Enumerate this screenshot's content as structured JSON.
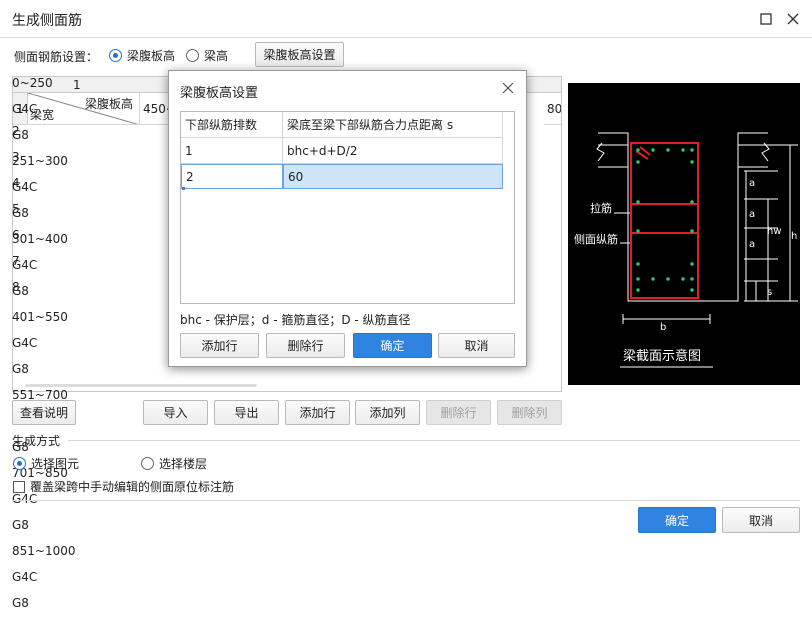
{
  "window": {
    "title": "生成侧面筋"
  },
  "side_bar_setting": {
    "label": "侧面钢筋设置：",
    "option_web_height": "梁腹板高",
    "option_beam_height": "梁高",
    "button": "梁腹板高设置"
  },
  "grid": {
    "col_header_1": "1",
    "corner_top": "梁腹板高",
    "corner_bottom": "梁宽",
    "col1_header_partial": "450<",
    "col_last_header_partial": "80",
    "rows": [
      {
        "num": "2",
        "width": "0~250",
        "val": "G4C",
        "last": "G8"
      },
      {
        "num": "3",
        "width": "251~300",
        "val": "G4C",
        "last": "G8"
      },
      {
        "num": "4",
        "width": "301~400",
        "val": "G4C",
        "last": "G8"
      },
      {
        "num": "5",
        "width": "401~550",
        "val": "G4C",
        "last": "G8"
      },
      {
        "num": "6",
        "width": "551~700",
        "val": "G4C",
        "last": "G8"
      },
      {
        "num": "7",
        "width": "701~850",
        "val": "G4C",
        "last": "G8"
      },
      {
        "num": "8",
        "width": "851~1000",
        "val": "G4C",
        "last": "G8"
      }
    ],
    "row1_num": "1"
  },
  "toolbar": {
    "help": "查看说明",
    "import": "导入",
    "export": "导出",
    "add_row": "添加行",
    "add_col": "添加列",
    "del_row": "删除行",
    "del_col": "删除列"
  },
  "generate": {
    "title": "生成方式",
    "option_select_element": "选择图元",
    "option_select_floor": "选择楼层",
    "overwrite_label": "覆盖梁跨中手动编辑的侧面原位标注筋"
  },
  "footer": {
    "ok": "确定",
    "cancel": "取消"
  },
  "dialog": {
    "title": "梁腹板高设置",
    "col1": "下部纵筋排数",
    "col2": "梁底至梁下部纵筋合力点距离 s",
    "rows": [
      {
        "n": "1",
        "s": "bhc+d+D/2"
      },
      {
        "n": "2",
        "s": "60"
      }
    ],
    "legend": "bhc - 保护层；d - 箍筋直径；D - 纵筋直径",
    "add_row": "添加行",
    "del_row": "删除行",
    "ok": "确定",
    "cancel": "取消"
  },
  "diagram": {
    "label_tie": "拉筋",
    "label_side": "侧面纵筋",
    "dim_a": "a",
    "dim_hw": "hw",
    "dim_h": "h",
    "dim_s": "s",
    "dim_b": "b",
    "caption": "梁截面示意图"
  }
}
